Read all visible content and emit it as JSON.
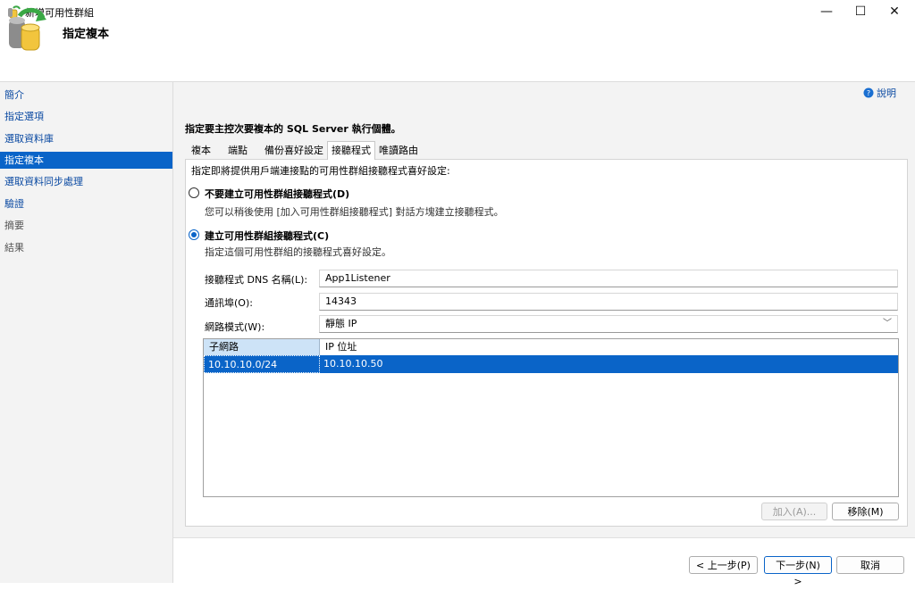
{
  "window": {
    "title": "新增可用性群組",
    "minimize": "—",
    "maximize": "☐",
    "close": "✕"
  },
  "header": {
    "title": "指定複本"
  },
  "sidebar": {
    "items": [
      {
        "label": "簡介",
        "state": "link"
      },
      {
        "label": "指定選項",
        "state": "link"
      },
      {
        "label": "選取資料庫",
        "state": "link"
      },
      {
        "label": "指定複本",
        "state": "selected"
      },
      {
        "label": "選取資料同步處理",
        "state": "link"
      },
      {
        "label": "驗證",
        "state": "link"
      },
      {
        "label": "摘要",
        "state": "disabled"
      },
      {
        "label": "結果",
        "state": "disabled"
      }
    ]
  },
  "main": {
    "help_label": "說明",
    "instruction": "指定要主控次要複本的 SQL Server 執行個體。",
    "tabs": [
      {
        "label": "複本",
        "active": false
      },
      {
        "label": "端點",
        "active": false
      },
      {
        "label": "備份喜好設定",
        "active": false
      },
      {
        "label": "接聽程式",
        "active": true
      },
      {
        "label": "唯讀路由",
        "active": false
      }
    ],
    "panel_description": "指定即將提供用戶端連接點的可用性群組接聽程式喜好設定:",
    "option_no": {
      "label": "不要建立可用性群組接聽程式(D)",
      "description": "您可以稍後使用 [加入可用性群組接聽程式] 對話方塊建立接聽程式。",
      "checked": false
    },
    "option_yes": {
      "label": "建立可用性群組接聽程式(C)",
      "description": "指定這個可用性群組的接聽程式喜好設定。",
      "checked": true
    },
    "fields": {
      "dns_label": "接聽程式 DNS 名稱(L):",
      "dns_value": "App1Listener",
      "port_label": "通訊埠(O):",
      "port_value": "14343",
      "mode_label": "網路模式(W):",
      "mode_value": "靜態 IP"
    },
    "grid": {
      "columns": [
        "子網路",
        "IP 位址"
      ],
      "rows": [
        {
          "subnet": "10.10.10.0/24",
          "ip": "10.10.10.50"
        }
      ]
    },
    "grid_buttons": {
      "add": "加入(A)...",
      "remove": "移除(M)"
    }
  },
  "footer": {
    "prev": "< 上一步(P)",
    "next": "下一步(N) >",
    "cancel": "取消"
  },
  "colors": {
    "accent": "#0a64c8",
    "link": "#0b4aa2",
    "panel_bg": "#f3f3f3"
  }
}
